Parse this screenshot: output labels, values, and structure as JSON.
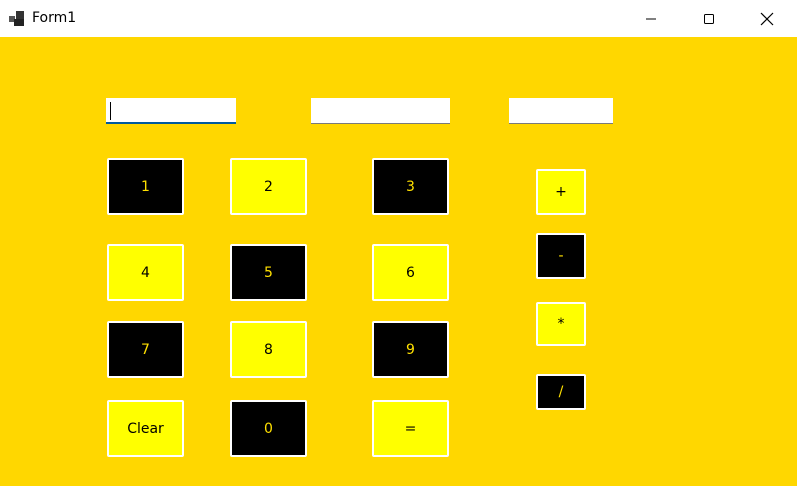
{
  "window": {
    "title": "Form1",
    "controls": {
      "minimize": "minimize-icon",
      "maximize": "maximize-icon",
      "close": "close-icon"
    }
  },
  "colors": {
    "form_bg": "#ffd700",
    "button_yellow": "#ffff00",
    "button_black": "#000000",
    "button_border": "#ffffff"
  },
  "inputs": {
    "first_operand": {
      "value": ""
    },
    "second_operand": {
      "value": ""
    },
    "result": {
      "value": ""
    }
  },
  "digits": {
    "d1": "1",
    "d2": "2",
    "d3": "3",
    "d4": "4",
    "d5": "5",
    "d6": "6",
    "d7": "7",
    "d8": "8",
    "d9": "9",
    "d0": "0"
  },
  "actions": {
    "clear": "Clear",
    "equals": "="
  },
  "operators": {
    "add": "+",
    "subtract": "-",
    "multiply": "*",
    "divide": "/"
  }
}
